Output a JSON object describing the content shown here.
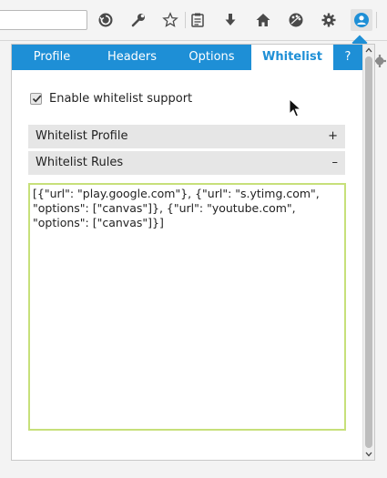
{
  "toolbar": {
    "url_value": "",
    "buttons": [
      {
        "icon": "history-icon"
      },
      {
        "icon": "wrench-icon"
      },
      {
        "icon": "star-icon"
      },
      {
        "icon": "clipboard-icon"
      },
      {
        "icon": "download-icon"
      },
      {
        "icon": "home-icon"
      },
      {
        "icon": "palette-icon"
      },
      {
        "icon": "gear-icon"
      },
      {
        "icon": "user-icon"
      }
    ],
    "accent": "#1e8fd6"
  },
  "tabs": [
    {
      "label": "Profile",
      "active": false
    },
    {
      "label": "Headers",
      "active": false
    },
    {
      "label": "Options",
      "active": false
    },
    {
      "label": "Whitelist",
      "active": true
    },
    {
      "label": "?",
      "active": false
    }
  ],
  "whitelist": {
    "enable_label": "Enable whitelist support",
    "enabled": true,
    "profile_section": {
      "label": "Whitelist Profile",
      "sign": "+"
    },
    "rules_section": {
      "label": "Whitelist Rules",
      "sign": "–"
    },
    "rules_text": "[{\"url\": \"play.google.com\"}, {\"url\": \"s.ytimg.com\", \"options\": [\"canvas\"]}, {\"url\": \"youtube.com\", \"options\": [\"canvas\"]}]"
  },
  "colors": {
    "tab_bar": "#1e8fd6",
    "textarea_border": "#c7e07a",
    "section_bg": "#e6e6e6"
  }
}
